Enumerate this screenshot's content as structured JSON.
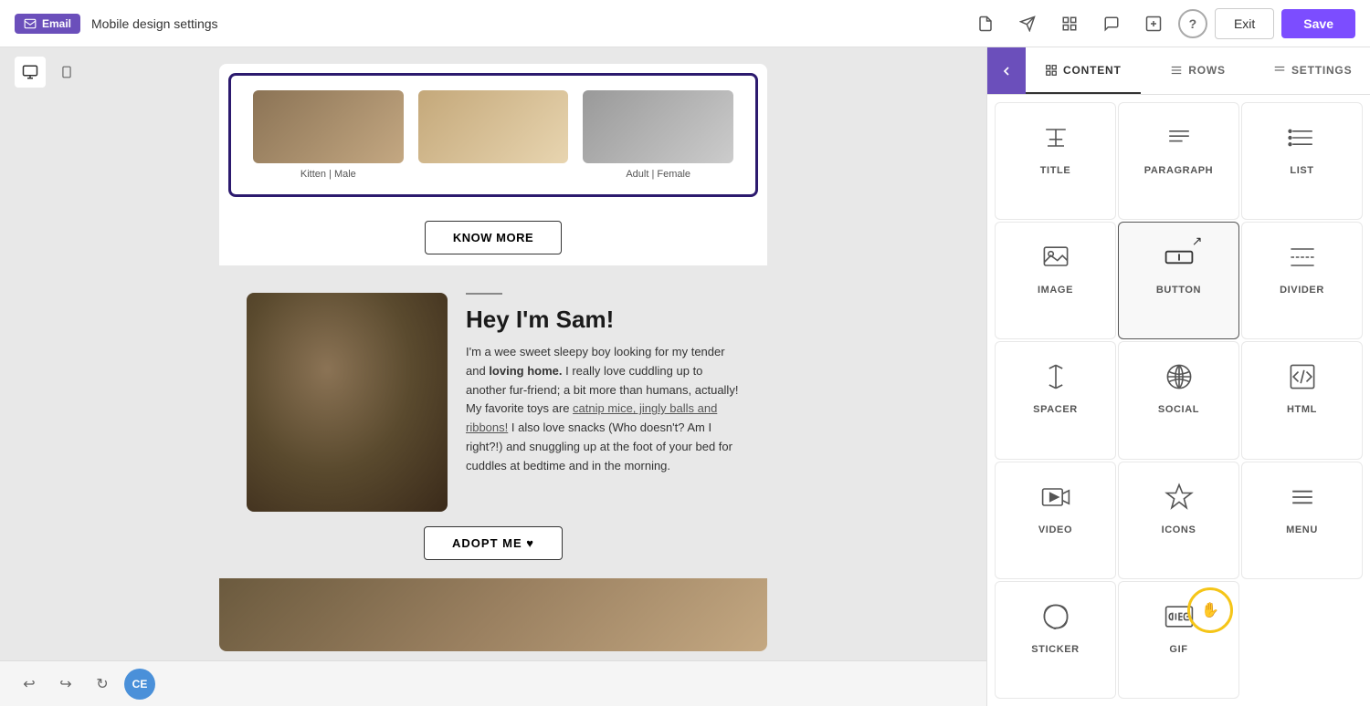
{
  "toolbar": {
    "email_badge": "Email",
    "title": "Mobile design settings",
    "exit_label": "Exit",
    "save_label": "Save",
    "help_label": "?",
    "icons": {
      "doc": "📄",
      "send": "➤",
      "grid": "⊞",
      "chat": "💬",
      "add": "⊕"
    }
  },
  "device_tabs": {
    "desktop_label": "desktop",
    "mobile_label": "mobile"
  },
  "email_preview": {
    "cats": [
      {
        "label": "Kitten | Male"
      },
      {
        "label": ""
      },
      {
        "label": "Adult | Female"
      }
    ],
    "know_more_btn": "KNOW MORE",
    "sam": {
      "title": "Hey I'm Sam!",
      "body_part1": "I'm a wee sweet sleepy boy looking for my tender and ",
      "body_bold": "loving home.",
      "body_part2": " I really love cuddling up to another fur-friend; a bit more than humans, actually! My favorite toys are ",
      "body_link": "catnip mice, jingly balls and ribbons!",
      "body_part3": " I also love snacks (Who doesn't? Am I right?!) and snuggling up at the foot of your bed for cuddles at bedtime and in the morning.",
      "adopt_btn": "ADOPT ME ♥"
    }
  },
  "panel": {
    "tabs": [
      {
        "label": "CONTENT",
        "active": true
      },
      {
        "label": "ROWS",
        "active": false
      },
      {
        "label": "SETTINGS",
        "active": false
      }
    ],
    "grid_items": [
      {
        "id": "title",
        "label": "TITLE",
        "icon": "title"
      },
      {
        "id": "paragraph",
        "label": "PARAGRAPH",
        "icon": "paragraph"
      },
      {
        "id": "list",
        "label": "LIST",
        "icon": "list"
      },
      {
        "id": "image",
        "label": "IMAGE",
        "icon": "image"
      },
      {
        "id": "button",
        "label": "BUTTON",
        "icon": "button",
        "active": true
      },
      {
        "id": "divider",
        "label": "DIVIDER",
        "icon": "divider"
      },
      {
        "id": "spacer",
        "label": "SPACER",
        "icon": "spacer"
      },
      {
        "id": "social",
        "label": "SOCIAL",
        "icon": "social"
      },
      {
        "id": "html",
        "label": "HTML",
        "icon": "html"
      },
      {
        "id": "video",
        "label": "VIDEO",
        "icon": "video"
      },
      {
        "id": "icons",
        "label": "ICONS",
        "icon": "icons"
      },
      {
        "id": "menu",
        "label": "MENU",
        "icon": "menu"
      },
      {
        "id": "sticker",
        "label": "STICKER",
        "icon": "sticker"
      },
      {
        "id": "gif",
        "label": "GIF",
        "icon": "gif",
        "highlighted": true
      }
    ]
  },
  "bottom_bar": {
    "ce_avatar": "CE"
  }
}
